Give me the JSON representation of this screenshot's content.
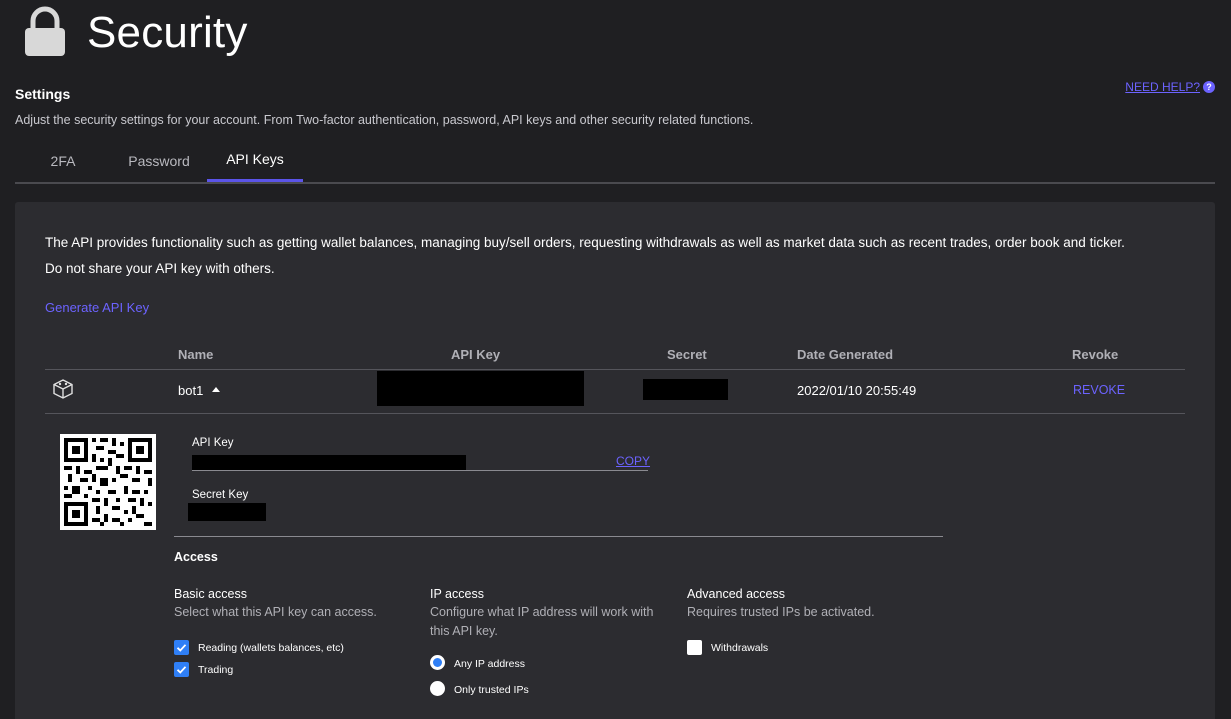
{
  "header": {
    "title": "Security",
    "lock_icon": "lock-icon",
    "help_link": "NEED HELP?",
    "help_icon_glyph": "?"
  },
  "settings": {
    "heading": "Settings",
    "description": "Adjust the security settings for your account. From Two-factor authentication, password, API keys and other security related functions."
  },
  "tabs": [
    {
      "label": "2FA",
      "active": false
    },
    {
      "label": "Password",
      "active": false
    },
    {
      "label": "API Keys",
      "active": true
    }
  ],
  "api_panel": {
    "intro_line1": "The API provides functionality such as getting wallet balances, managing buy/sell orders, requesting withdrawals as well as market data such as recent trades, order book and ticker.",
    "intro_line2": "Do not share your API key with others.",
    "generate_link": "Generate API Key",
    "columns": [
      "Name",
      "API Key",
      "Secret",
      "Date Generated",
      "Revoke"
    ],
    "rows": [
      {
        "icon": "cube-icon",
        "name": "bot1",
        "api_key": "[redacted]",
        "secret": "[redacted]",
        "date_generated": "2022/01/10 20:55:49",
        "revoke": "REVOKE",
        "expanded": true
      }
    ]
  },
  "detail": {
    "api_key_label": "API Key",
    "copy_link": "COPY",
    "secret_key_label": "Secret Key",
    "access_heading": "Access",
    "basic": {
      "title": "Basic access",
      "desc": "Select what this API key can access.",
      "options": [
        {
          "label": "Reading (wallets balances, etc)",
          "checked": true
        },
        {
          "label": "Trading",
          "checked": true
        }
      ]
    },
    "ip": {
      "title": "IP access",
      "desc_line1": "Configure what IP address will work with",
      "desc_line2": "this API key.",
      "options": [
        {
          "label": "Any IP address",
          "selected": true
        },
        {
          "label": "Only trusted IPs",
          "selected": false
        }
      ]
    },
    "advanced": {
      "title": "Advanced access",
      "desc": "Requires trusted IPs be activated.",
      "options": [
        {
          "label": "Withdrawals",
          "checked": false
        }
      ]
    }
  },
  "colors": {
    "background": "#1f1f22",
    "panel": "#2c2c30",
    "accent": "#6c63ff",
    "tab_indicator": "#5b54e8",
    "checkbox_blue": "#2f7ff6"
  }
}
